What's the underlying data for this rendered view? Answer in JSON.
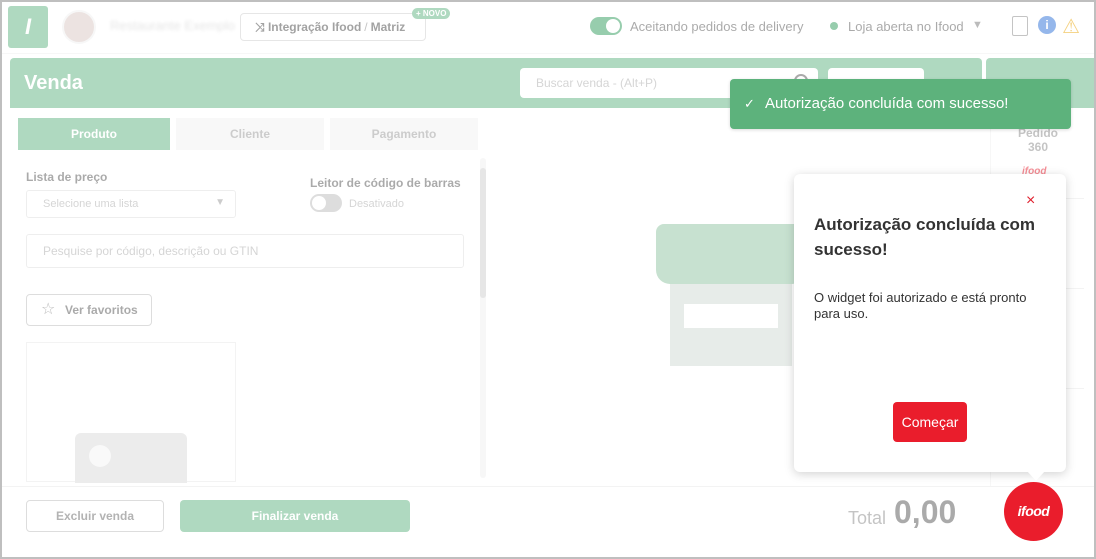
{
  "topbar": {
    "logo_letter": "I",
    "store_name": "Restaurante Exemplo",
    "integration_label": "Integração Ifood",
    "integration_sep": "/",
    "integration_scope": "Matriz",
    "new_badge": "NOVO",
    "delivery_toggle_label": "Aceitando pedidos de delivery",
    "store_status": "Loja aberta no Ifood",
    "store_status_caret": "▼",
    "info_icon": "i",
    "warning_icon": "⚠"
  },
  "header": {
    "title": "Venda",
    "search_placeholder": "Buscar venda - (Alt+P)"
  },
  "steps": [
    "Produto",
    "Cliente",
    "Pagamento"
  ],
  "left_panel": {
    "price_list_label": "Lista de preço",
    "price_list_placeholder": "Selecione uma lista",
    "barcode_label": "Leitor de código de barras",
    "barcode_state": "Desativado",
    "product_search_placeholder": "Pesquise por código, descrição ou GTIN",
    "favorites_button": "Ver favoritos"
  },
  "right_column": {
    "pedido_label": "Pedido",
    "pedido_number": "360",
    "ifood_mini": "ifood"
  },
  "bottom": {
    "delete_button": "Excluir venda",
    "finish_button": "Finalizar venda",
    "total_label": "Total",
    "total_value": "0,00"
  },
  "toast": {
    "icon": "✓",
    "message": "Autorização concluída com sucesso!"
  },
  "dialog": {
    "close_icon": "×",
    "title": "Autorização concluída com sucesso!",
    "body": "O widget foi autorizado e está pronto para uso.",
    "button": "Começar"
  },
  "fab": {
    "label": "ifood"
  },
  "colors": {
    "brand_green": "#5fb380",
    "ifood_red": "#ea1d2c",
    "toast_green": "#5db27c"
  }
}
